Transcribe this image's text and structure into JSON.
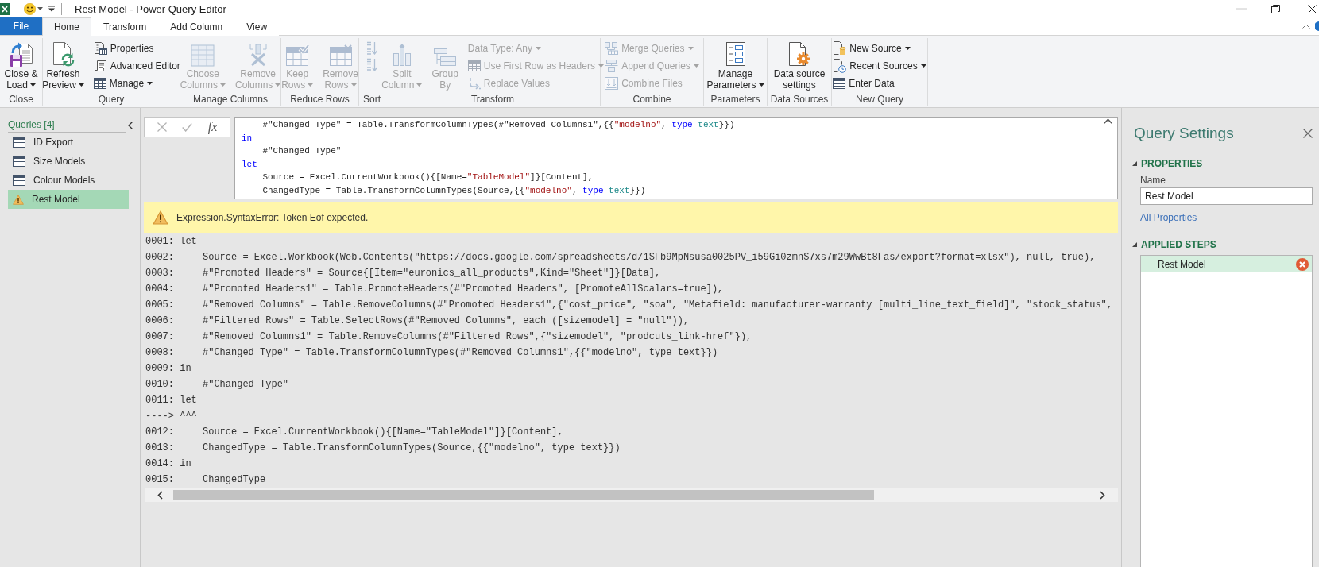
{
  "window": {
    "title": "Rest Model - Power Query Editor"
  },
  "ribbon_tabs": [
    {
      "label": "File",
      "kind": "file",
      "selected": false
    },
    {
      "label": "Home",
      "kind": "tab",
      "selected": true
    },
    {
      "label": "Transform",
      "kind": "tab",
      "selected": false
    },
    {
      "label": "Add Column",
      "kind": "tab",
      "selected": false
    },
    {
      "label": "View",
      "kind": "tab",
      "selected": false
    }
  ],
  "ribbon_groups": [
    {
      "label": "Close",
      "items": [
        {
          "kind": "large",
          "lines": [
            "Close &",
            "Load"
          ],
          "menu": true,
          "disabled": false
        }
      ]
    },
    {
      "label": "Query",
      "items": [
        {
          "kind": "large",
          "lines": [
            "Refresh",
            "Preview"
          ],
          "menu": true,
          "disabled": false
        },
        {
          "kind": "small",
          "label": "Properties",
          "menu": false,
          "disabled": false
        },
        {
          "kind": "small",
          "label": "Advanced Editor",
          "menu": false,
          "disabled": false
        },
        {
          "kind": "small",
          "label": "Manage",
          "menu": true,
          "disabled": false
        }
      ]
    },
    {
      "label": "Manage Columns",
      "items": [
        {
          "kind": "large",
          "lines": [
            "Choose",
            "Columns"
          ],
          "menu": true,
          "disabled": true
        },
        {
          "kind": "large",
          "lines": [
            "Remove",
            "Columns"
          ],
          "menu": true,
          "disabled": true
        }
      ]
    },
    {
      "label": "Reduce Rows",
      "items": [
        {
          "kind": "large",
          "lines": [
            "Keep",
            "Rows"
          ],
          "menu": true,
          "disabled": true
        },
        {
          "kind": "large",
          "lines": [
            "Remove",
            "Rows"
          ],
          "menu": true,
          "disabled": true
        }
      ]
    },
    {
      "label": "Sort",
      "items": [
        {
          "kind": "icon",
          "disabled": true
        },
        {
          "kind": "icon",
          "disabled": true
        }
      ]
    },
    {
      "label": "Transform",
      "items": [
        {
          "kind": "large",
          "lines": [
            "Split",
            "Column"
          ],
          "menu": true,
          "disabled": true
        },
        {
          "kind": "large",
          "lines": [
            "Group",
            "By"
          ],
          "menu": false,
          "disabled": true
        },
        {
          "kind": "small",
          "label": "Data Type: Any",
          "menu": true,
          "disabled": true
        },
        {
          "kind": "small",
          "label": "Use First Row as Headers",
          "menu": true,
          "disabled": true
        },
        {
          "kind": "small",
          "label": "Replace Values",
          "menu": false,
          "disabled": true
        }
      ]
    },
    {
      "label": "Combine",
      "items": [
        {
          "kind": "small",
          "label": "Merge Queries",
          "menu": true,
          "disabled": true
        },
        {
          "kind": "small",
          "label": "Append Queries",
          "menu": true,
          "disabled": true
        },
        {
          "kind": "small",
          "label": "Combine Files",
          "menu": false,
          "disabled": true
        }
      ]
    },
    {
      "label": "Parameters",
      "items": [
        {
          "kind": "large",
          "lines": [
            "Manage",
            "Parameters"
          ],
          "menu": true,
          "disabled": false
        }
      ]
    },
    {
      "label": "Data Sources",
      "items": [
        {
          "kind": "large",
          "lines": [
            "Data source",
            "settings"
          ],
          "menu": false,
          "disabled": false
        }
      ]
    },
    {
      "label": "New Query",
      "items": [
        {
          "kind": "small",
          "label": "New Source",
          "menu": true,
          "disabled": false
        },
        {
          "kind": "small",
          "label": "Recent Sources",
          "menu": true,
          "disabled": false
        },
        {
          "kind": "small",
          "label": "Enter Data",
          "menu": false,
          "disabled": false
        }
      ]
    }
  ],
  "queries_panel": {
    "header": "Queries [4]",
    "items": [
      {
        "name": "ID Export",
        "kind": "table",
        "selected": false
      },
      {
        "name": "Size Models",
        "kind": "table",
        "selected": false
      },
      {
        "name": "Colour Models",
        "kind": "table",
        "selected": false
      },
      {
        "name": "Rest Model",
        "kind": "error",
        "selected": true
      }
    ]
  },
  "formula_bar": {
    "function_label": "fx",
    "lines": [
      [
        {
          "kind": "plain",
          "text": "    #\"Changed Type\" = Table.TransformColumnTypes(#\"Removed Columns1\",{{"
        },
        {
          "kind": "string",
          "text": "\"modelno\""
        },
        {
          "kind": "plain",
          "text": ", "
        },
        {
          "kind": "keyword",
          "text": "type"
        },
        {
          "kind": "type",
          "text": " text"
        },
        {
          "kind": "plain",
          "text": "}})"
        }
      ],
      [
        {
          "kind": "keyword",
          "text": "in"
        }
      ],
      [
        {
          "kind": "plain",
          "text": "    #\"Changed Type\""
        }
      ],
      [
        {
          "kind": "keyword",
          "text": "let"
        }
      ],
      [
        {
          "kind": "plain",
          "text": "    Source = Excel.CurrentWorkbook(){[Name="
        },
        {
          "kind": "string",
          "text": "\"TableModel\""
        },
        {
          "kind": "plain",
          "text": "]}[Content],"
        }
      ],
      [
        {
          "kind": "plain",
          "text": "    ChangedType = Table.TransformColumnTypes(Source,{{"
        },
        {
          "kind": "string",
          "text": "\"modelno\""
        },
        {
          "kind": "plain",
          "text": ", "
        },
        {
          "kind": "keyword",
          "text": "type"
        },
        {
          "kind": "type",
          "text": " text"
        },
        {
          "kind": "plain",
          "text": "}})"
        }
      ]
    ]
  },
  "error_bar": {
    "message": "Expression.SyntaxError: Token Eof expected."
  },
  "code_listing": {
    "lines": [
      "0001: let",
      "0002:     Source = Excel.Workbook(Web.Contents(\"https://docs.google.com/spreadsheets/d/1SFb9MpNsusa0025PV_i59Gi0zmnS7xs7m29WwBt8Fas/export?format=xlsx\"), null, true),",
      "0003:     #\"Promoted Headers\" = Source{[Item=\"euronics_all_products\",Kind=\"Sheet\"]}[Data],",
      "0004:     #\"Promoted Headers1\" = Table.PromoteHeaders(#\"Promoted Headers\", [PromoteAllScalars=true]),",
      "0005:     #\"Removed Columns\" = Table.RemoveColumns(#\"Promoted Headers1\",{\"cost_price\", \"soa\", \"Metafield: manufacturer-warranty [multi_line_text_field]\", \"stock_status\",",
      "0006:     #\"Filtered Rows\" = Table.SelectRows(#\"Removed Columns\", each ([sizemodel] = \"null\")),",
      "0007:     #\"Removed Columns1\" = Table.RemoveColumns(#\"Filtered Rows\",{\"sizemodel\", \"prodcuts_link-href\"}),",
      "0008:     #\"Changed Type\" = Table.TransformColumnTypes(#\"Removed Columns1\",{{\"modelno\", type text}})",
      "0009: in",
      "0010:     #\"Changed Type\"",
      "0011: let",
      "----> ^^^",
      "0012:     Source = Excel.CurrentWorkbook(){[Name=\"TableModel\"]}[Content],",
      "0013:     ChangedType = Table.TransformColumnTypes(Source,{{\"modelno\", type text}})",
      "0014: in",
      "0015:     ChangedType"
    ]
  },
  "query_settings": {
    "title": "Query Settings",
    "properties": {
      "heading": "PROPERTIES",
      "expanded": true,
      "name_label": "Name",
      "name_value": "Rest Model",
      "link": "All Properties"
    },
    "applied_steps": {
      "heading": "APPLIED STEPS",
      "expanded": true,
      "steps": [
        {
          "name": "Rest Model",
          "selected": true,
          "error": true
        }
      ]
    }
  }
}
